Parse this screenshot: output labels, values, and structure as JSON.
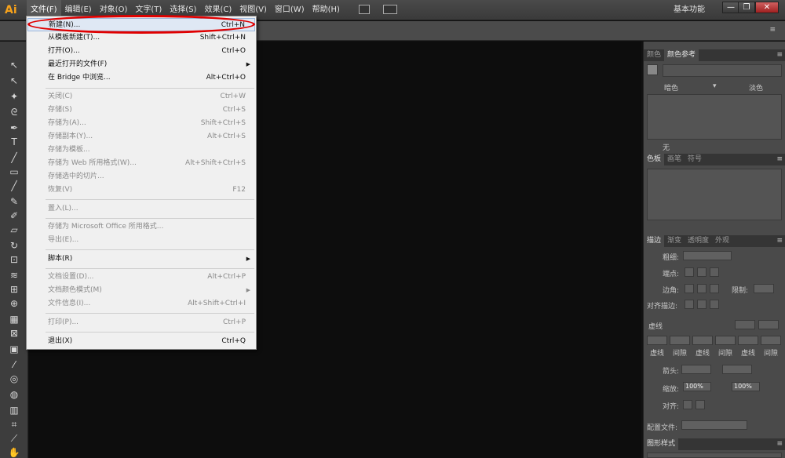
{
  "app": {
    "logo": "Ai",
    "workspace": "基本功能"
  },
  "menubar": {
    "items": [
      "文件(F)",
      "编辑(E)",
      "对象(O)",
      "文字(T)",
      "选择(S)",
      "效果(C)",
      "视图(V)",
      "窗口(W)",
      "帮助(H)"
    ]
  },
  "window_controls": {
    "minimize": "—",
    "restore": "❐",
    "close": "✕"
  },
  "file_menu": {
    "items": [
      {
        "label": "新建(N)...",
        "shortcut": "Ctrl+N"
      },
      {
        "label": "从模板新建(T)...",
        "shortcut": "Shift+Ctrl+N"
      },
      {
        "label": "打开(O)...",
        "shortcut": "Ctrl+O"
      },
      {
        "label": "最近打开的文件(F)",
        "shortcut": ""
      },
      {
        "label": "在 Bridge 中浏览...",
        "shortcut": "Alt+Ctrl+O"
      },
      {
        "label": "关闭(C)",
        "shortcut": "Ctrl+W"
      },
      {
        "label": "存储(S)",
        "shortcut": "Ctrl+S"
      },
      {
        "label": "存储为(A)...",
        "shortcut": "Shift+Ctrl+S"
      },
      {
        "label": "存储副本(Y)...",
        "shortcut": "Alt+Ctrl+S"
      },
      {
        "label": "存储为模板...",
        "shortcut": ""
      },
      {
        "label": "存储为 Web 所用格式(W)...",
        "shortcut": "Alt+Shift+Ctrl+S"
      },
      {
        "label": "存储选中的切片...",
        "shortcut": ""
      },
      {
        "label": "恢复(V)",
        "shortcut": "F12"
      },
      {
        "label": "置入(L)...",
        "shortcut": ""
      },
      {
        "label": "存储为 Microsoft Office 所用格式...",
        "shortcut": ""
      },
      {
        "label": "导出(E)...",
        "shortcut": ""
      },
      {
        "label": "脚本(R)",
        "shortcut": ""
      },
      {
        "label": "文档设置(D)...",
        "shortcut": "Alt+Ctrl+P"
      },
      {
        "label": "文档颜色模式(M)",
        "shortcut": ""
      },
      {
        "label": "文件信息(I)...",
        "shortcut": "Alt+Shift+Ctrl+I"
      },
      {
        "label": "打印(P)...",
        "shortcut": "Ctrl+P"
      },
      {
        "label": "退出(X)",
        "shortcut": "Ctrl+Q"
      }
    ]
  },
  "color_panel": {
    "tabs": [
      "颜色",
      "颜色参考"
    ],
    "dark_label": "暗色",
    "light_label": "淡色",
    "none_label": "无"
  },
  "swatches_panel": {
    "tabs": [
      "色板",
      "画笔",
      "符号"
    ]
  },
  "stroke_panel": {
    "tabs": [
      "描边",
      "渐变",
      "透明度",
      "外观"
    ],
    "weight_label": "粗细:",
    "cap_label": "端点:",
    "corner_label": "边角:",
    "limit_label": "限制:",
    "align_label": "对齐描边:",
    "dashed_label": "虚线",
    "dash_labels": [
      "虚线",
      "间隙",
      "虚线",
      "间隙",
      "虚线",
      "间隙"
    ],
    "arrow_label": "箭头:",
    "scale_label": "缩放:",
    "scale_value_1": "100%",
    "scale_value_2": "100%",
    "align2_label": "对齐:",
    "profile_label": "配置文件:"
  },
  "graphic_styles_panel": {
    "tabs": [
      "图形样式"
    ]
  },
  "colors": {
    "accent": "#f7a21b",
    "highlight_oval": "#e00000"
  }
}
